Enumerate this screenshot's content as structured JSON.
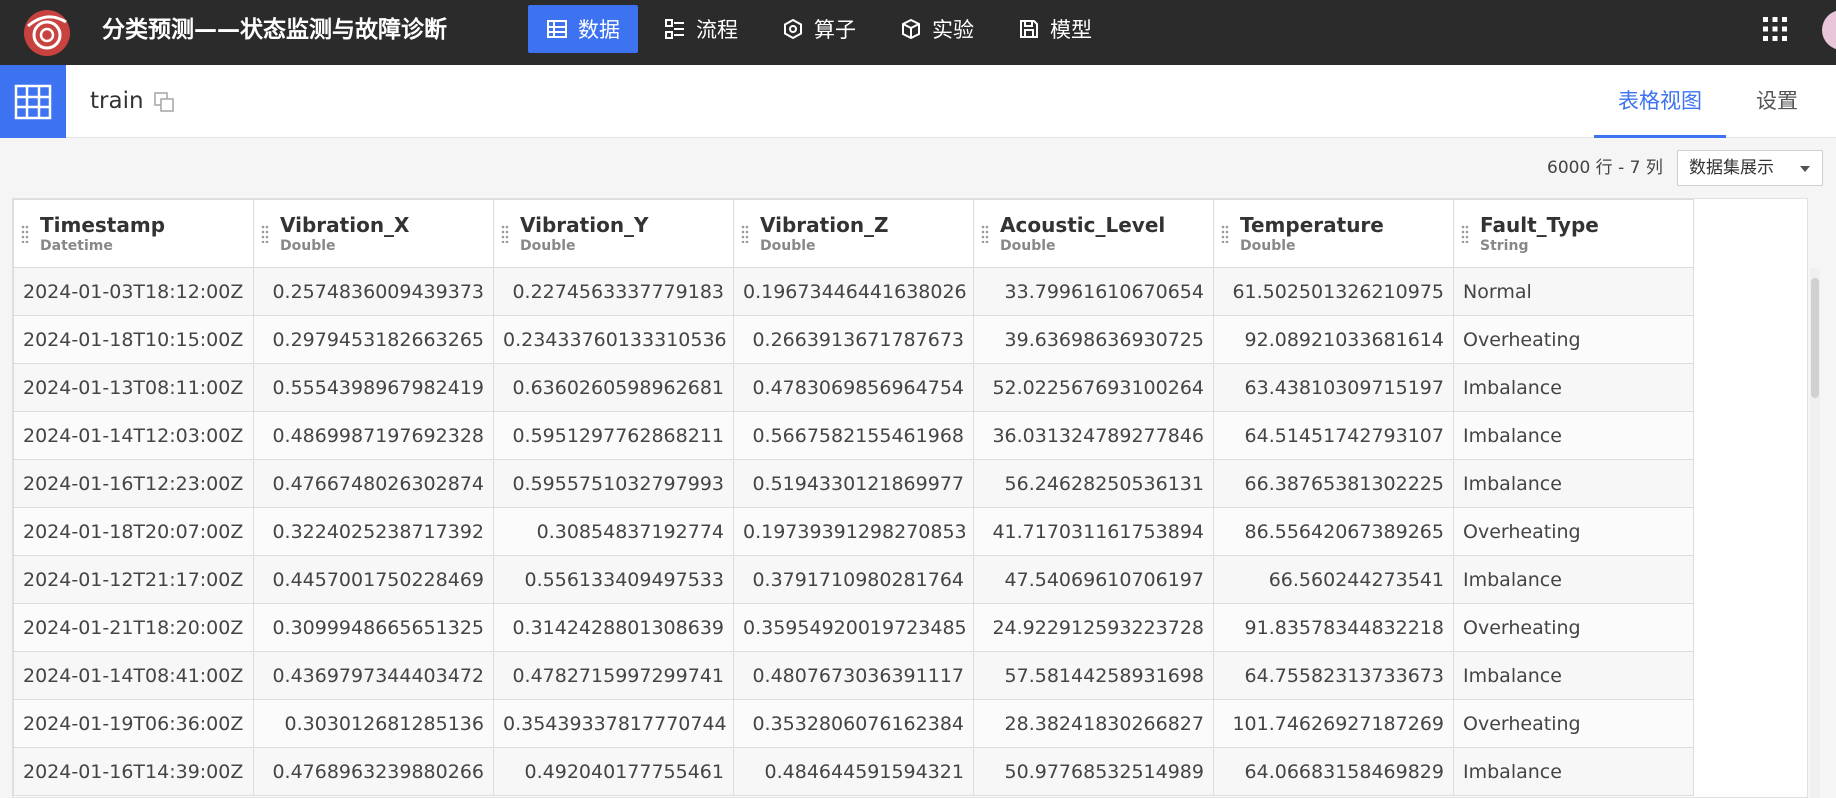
{
  "app": {
    "title": "分类预测——状态监测与故障诊断",
    "accent_color": "#3d73f0",
    "topbar_color": "#2b2b2b"
  },
  "nav": {
    "items": [
      {
        "label": "数据",
        "icon": "table-icon",
        "active": true
      },
      {
        "label": "流程",
        "icon": "flow-icon",
        "active": false
      },
      {
        "label": "算子",
        "icon": "operator-icon",
        "active": false
      },
      {
        "label": "实验",
        "icon": "cube-icon",
        "active": false
      },
      {
        "label": "模型",
        "icon": "save-icon",
        "active": false
      }
    ]
  },
  "dataset": {
    "name": "train",
    "tabs": [
      {
        "label": "表格视图",
        "active": true
      },
      {
        "label": "设置",
        "active": false
      }
    ],
    "info": "6000 行 - 7 列",
    "display_select": "数据集展示"
  },
  "table": {
    "columns": [
      {
        "name": "Timestamp",
        "type": "Datetime"
      },
      {
        "name": "Vibration_X",
        "type": "Double"
      },
      {
        "name": "Vibration_Y",
        "type": "Double"
      },
      {
        "name": "Vibration_Z",
        "type": "Double"
      },
      {
        "name": "Acoustic_Level",
        "type": "Double"
      },
      {
        "name": "Temperature",
        "type": "Double"
      },
      {
        "name": "Fault_Type",
        "type": "String"
      }
    ],
    "rows": [
      [
        "2024-01-03T18:12:00Z",
        "0.2574836009439373",
        "0.2274563337779183",
        "0.19673446441638026",
        "33.79961610670654",
        "61.502501326210975",
        "Normal"
      ],
      [
        "2024-01-18T10:15:00Z",
        "0.2979453182663265",
        "0.23433760133310536",
        "0.2663913671787673",
        "39.63698636930725",
        "92.08921033681614",
        "Overheating"
      ],
      [
        "2024-01-13T08:11:00Z",
        "0.5554398967982419",
        "0.6360260598962681",
        "0.4783069856964754",
        "52.022567693100264",
        "63.43810309715197",
        "Imbalance"
      ],
      [
        "2024-01-14T12:03:00Z",
        "0.4869987197692328",
        "0.5951297762868211",
        "0.5667582155461968",
        "36.031324789277846",
        "64.51451742793107",
        "Imbalance"
      ],
      [
        "2024-01-16T12:23:00Z",
        "0.4766748026302874",
        "0.5955751032797993",
        "0.5194330121869977",
        "56.24628250536131",
        "66.38765381302225",
        "Imbalance"
      ],
      [
        "2024-01-18T20:07:00Z",
        "0.3224025238717392",
        "0.30854837192774",
        "0.19739391298270853",
        "41.71703116175389​4",
        "86.55642067389265",
        "Overheating"
      ],
      [
        "2024-01-12T21:17:00Z",
        "0.4457001750228469",
        "0.556133409497533",
        "0.3791710980281764",
        "47.54069610706197",
        "66.560244273541",
        "Imbalance"
      ],
      [
        "2024-01-21T18:20:00Z",
        "0.3099948665651325",
        "0.3142428801308639",
        "0.35954920019723485",
        "24.922912593223728",
        "91.83578344832218",
        "Overheating"
      ],
      [
        "2024-01-14T08:41:00Z",
        "0.4369797344403472",
        "0.4782715997299741",
        "0.4807673036391117",
        "57.58144258931698",
        "64.75582313733673",
        "Imbalance"
      ],
      [
        "2024-01-19T06:36:00Z",
        "0.303012681285136",
        "0.35439337817770744",
        "0.3532806076162384",
        "28.38241830266827",
        "101.74626927187269",
        "Overheating"
      ],
      [
        "2024-01-16T14:39:00Z",
        "0.4768963239880266",
        "0.492040177755461",
        "0.484644591594321",
        "50.97768532514989",
        "64.06683158469829",
        "Imbalance"
      ]
    ]
  }
}
